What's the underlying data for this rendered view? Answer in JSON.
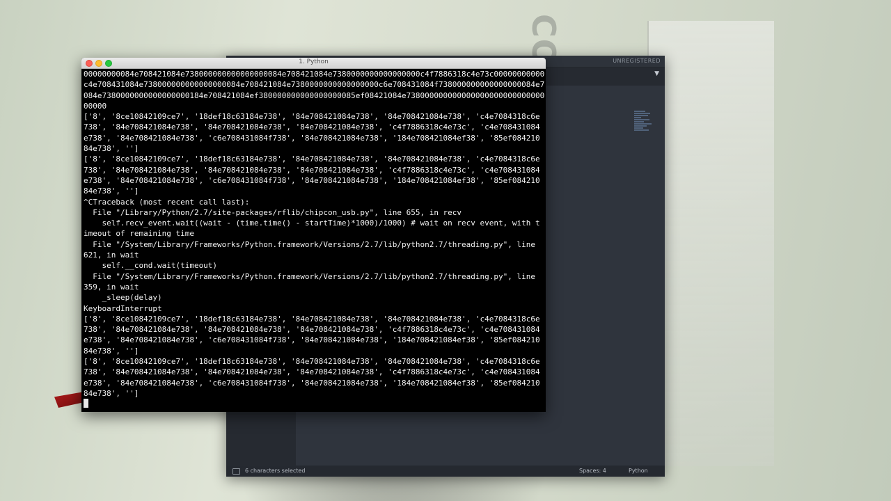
{
  "desktop": {
    "wallpaper_letters": "CON"
  },
  "editor": {
    "unregistered_label": "UNREGISTERED",
    "tab_dropdown_icon": "triangle-down-icon",
    "status": {
      "selection_text": "6 characters selected",
      "spaces": "Spaces: 4",
      "syntax": "Python"
    }
  },
  "terminal": {
    "title": "1. Python",
    "lines": [
      "00000000084e708421084e738000000000000000084e708421084e7380000000000000000c4f7886318c4e73c000000000000",
      "c4e708431084e738000000000000000084e708421084e7380000000000000000c6e708431084f738000000000000000084e708421",
      "084e7380000000000000000184e708421084ef380000000000000000085ef08421084e738000000000000000000000000000000000",
      "00000",
      "['8', '8ce10842109ce7', '18def18c63184e738', '84e708421084e738', '84e708421084e738', 'c4e7084318c6e",
      "738', '84e708421084e738', '84e708421084e738', '84e708421084e738', 'c4f7886318c4e73c', 'c4e708431084",
      "e738', '84e708421084e738', 'c6e708431084f738', '84e708421084e738', '184e708421084ef38', '85ef084210",
      "84e738', '']",
      "['8', '8ce10842109ce7', '18def18c63184e738', '84e708421084e738', '84e708421084e738', 'c4e7084318c6e",
      "738', '84e708421084e738', '84e708421084e738', '84e708421084e738', 'c4f7886318c4e73c', 'c4e708431084",
      "e738', '84e708421084e738', 'c6e708431084f738', '84e708421084e738', '184e708421084ef38', '85ef084210",
      "84e738', '']",
      "^CTraceback (most recent call last):",
      "  File \"/Library/Python/2.7/site-packages/rflib/chipcon_usb.py\", line 655, in recv",
      "    self.recv_event.wait((wait - (time.time() - startTime)*1000)/1000) # wait on recv event, with t",
      "imeout of remaining time",
      "  File \"/System/Library/Frameworks/Python.framework/Versions/2.7/lib/python2.7/threading.py\", line",
      "621, in wait",
      "    self.__cond.wait(timeout)",
      "  File \"/System/Library/Frameworks/Python.framework/Versions/2.7/lib/python2.7/threading.py\", line",
      "359, in wait",
      "    _sleep(delay)",
      "KeyboardInterrupt",
      "['8', '8ce10842109ce7', '18def18c63184e738', '84e708421084e738', '84e708421084e738', 'c4e7084318c6e",
      "738', '84e708421084e738', '84e708421084e738', '84e708421084e738', 'c4f7886318c4e73c', 'c4e708431084",
      "e738', '84e708421084e738', 'c6e708431084f738', '84e708421084e738', '184e708421084ef38', '85ef084210",
      "84e738', '']",
      "['8', '8ce10842109ce7', '18def18c63184e738', '84e708421084e738', '84e708421084e738', 'c4e7084318c6e",
      "738', '84e708421084e738', '84e708421084e738', '84e708421084e738', 'c4f7886318c4e73c', 'c4e708431084",
      "e738', '84e708421084e738', 'c6e708431084f738', '84e708421084e738', '184e708421084ef38', '85ef084210",
      "84e738', '']"
    ]
  }
}
